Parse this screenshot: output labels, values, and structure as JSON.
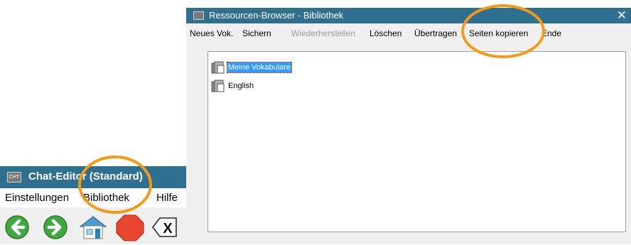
{
  "chat_editor": {
    "title": "Chat-Editor (Standard)",
    "app_icon_text": "CHT",
    "menu": [
      "Einstellungen",
      "Bibliothek",
      "Hilfe"
    ],
    "toolbar": [
      "back-arrow-icon",
      "forward-arrow-icon",
      "home-icon",
      "stop-icon",
      "delete-icon"
    ],
    "toolbar_delete_glyph": "X"
  },
  "resource_browser": {
    "title": "Ressourcen-Browser - Bibliothek",
    "close_glyph": "✕",
    "menu": [
      {
        "label": "Neues Vok.",
        "enabled": true
      },
      {
        "label": "Sichern",
        "enabled": true
      },
      {
        "label": "Wiederherstellen",
        "enabled": false
      },
      {
        "label": "Löschen",
        "enabled": true
      },
      {
        "label": "Übertragen",
        "enabled": true
      },
      {
        "label": "Seiten kopieren",
        "enabled": true
      },
      {
        "label": "Ende",
        "enabled": true
      }
    ],
    "items": [
      {
        "label": "Meine Vokabulare",
        "selected": true,
        "icon": "library-icon"
      },
      {
        "label": "English",
        "selected": false,
        "icon": "library-icon"
      }
    ]
  },
  "colors": {
    "titlebar": "#2f7091",
    "highlight": "#f39b16",
    "selection": "#3399ff"
  }
}
